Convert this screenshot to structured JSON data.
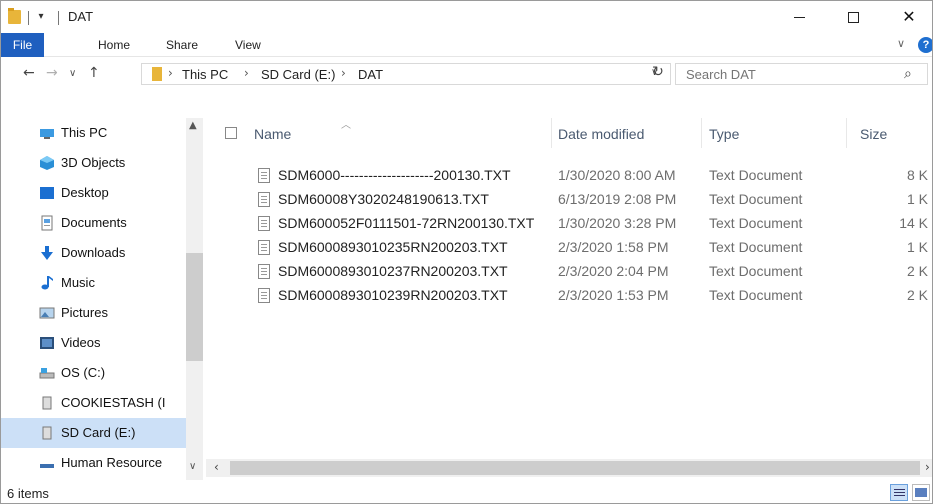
{
  "window": {
    "title": "DAT",
    "dropdown_glyph": "▾",
    "minimize_icon": "minimize-icon",
    "maximize_icon": "maximize-icon",
    "close_icon": "close-icon",
    "close_glyph": "✕"
  },
  "ribbon": {
    "tabs": [
      "File",
      "Home",
      "Share",
      "View"
    ],
    "active_tab_color": "#1f5fbf",
    "expand_glyph": "∨",
    "help_glyph": "?"
  },
  "nav": {
    "back_glyph": "←",
    "forward_glyph": "→",
    "recent_glyph": "∨",
    "up_glyph": "↑",
    "breadcrumb": [
      "This PC",
      "SD Card (E:)",
      "DAT"
    ],
    "crumb_separator": "›",
    "address_dropdown_glyph": "∨",
    "refresh_glyph": "↻",
    "search_placeholder": "Search DAT",
    "search_glyph": "⌕"
  },
  "sidebar": {
    "items": [
      {
        "label": "This PC",
        "icon": "this-pc-icon",
        "selected": false
      },
      {
        "label": "3D Objects",
        "icon": "3d-objects-icon",
        "selected": false
      },
      {
        "label": "Desktop",
        "icon": "desktop-icon",
        "selected": false
      },
      {
        "label": "Documents",
        "icon": "documents-icon",
        "selected": false
      },
      {
        "label": "Downloads",
        "icon": "downloads-icon",
        "selected": false
      },
      {
        "label": "Music",
        "icon": "music-icon",
        "selected": false
      },
      {
        "label": "Pictures",
        "icon": "pictures-icon",
        "selected": false
      },
      {
        "label": "Videos",
        "icon": "videos-icon",
        "selected": false
      },
      {
        "label": "OS (C:)",
        "icon": "drive-icon",
        "selected": false
      },
      {
        "label": "COOKIESTASH (I",
        "icon": "usb-drive-icon",
        "selected": false
      },
      {
        "label": "SD Card (E:)",
        "icon": "sd-card-icon",
        "selected": true
      },
      {
        "label": "Human Resource",
        "icon": "network-drive-icon",
        "selected": false
      }
    ],
    "selected_color": "#cce0f7",
    "scroll_up_glyph": "▲",
    "scroll_down_glyph": "∨"
  },
  "columns": {
    "name": "Name",
    "date": "Date modified",
    "type": "Type",
    "size": "Size",
    "sort_glyph": "︿"
  },
  "files": [
    {
      "name": "SDM6000--------------------200130.TXT",
      "date": "1/30/2020 8:00 AM",
      "type": "Text Document",
      "size": "8 K"
    },
    {
      "name": "SDM60008Y3020248190613.TXT",
      "date": "6/13/2019 2:08 PM",
      "type": "Text Document",
      "size": "1 K"
    },
    {
      "name": "SDM600052F0111501-72RN200130.TXT",
      "date": "1/30/2020 3:28 PM",
      "type": "Text Document",
      "size": "14 K"
    },
    {
      "name": "SDM6000893010235RN200203.TXT",
      "date": "2/3/2020 1:58 PM",
      "type": "Text Document",
      "size": "1 K"
    },
    {
      "name": "SDM6000893010237RN200203.TXT",
      "date": "2/3/2020 2:04 PM",
      "type": "Text Document",
      "size": "2 K"
    },
    {
      "name": "SDM6000893010239RN200203.TXT",
      "date": "2/3/2020 1:53 PM",
      "type": "Text Document",
      "size": "2 K"
    }
  ],
  "hscroll": {
    "left_glyph": "‹",
    "right_glyph": "›"
  },
  "status": {
    "item_count": "6 items"
  }
}
